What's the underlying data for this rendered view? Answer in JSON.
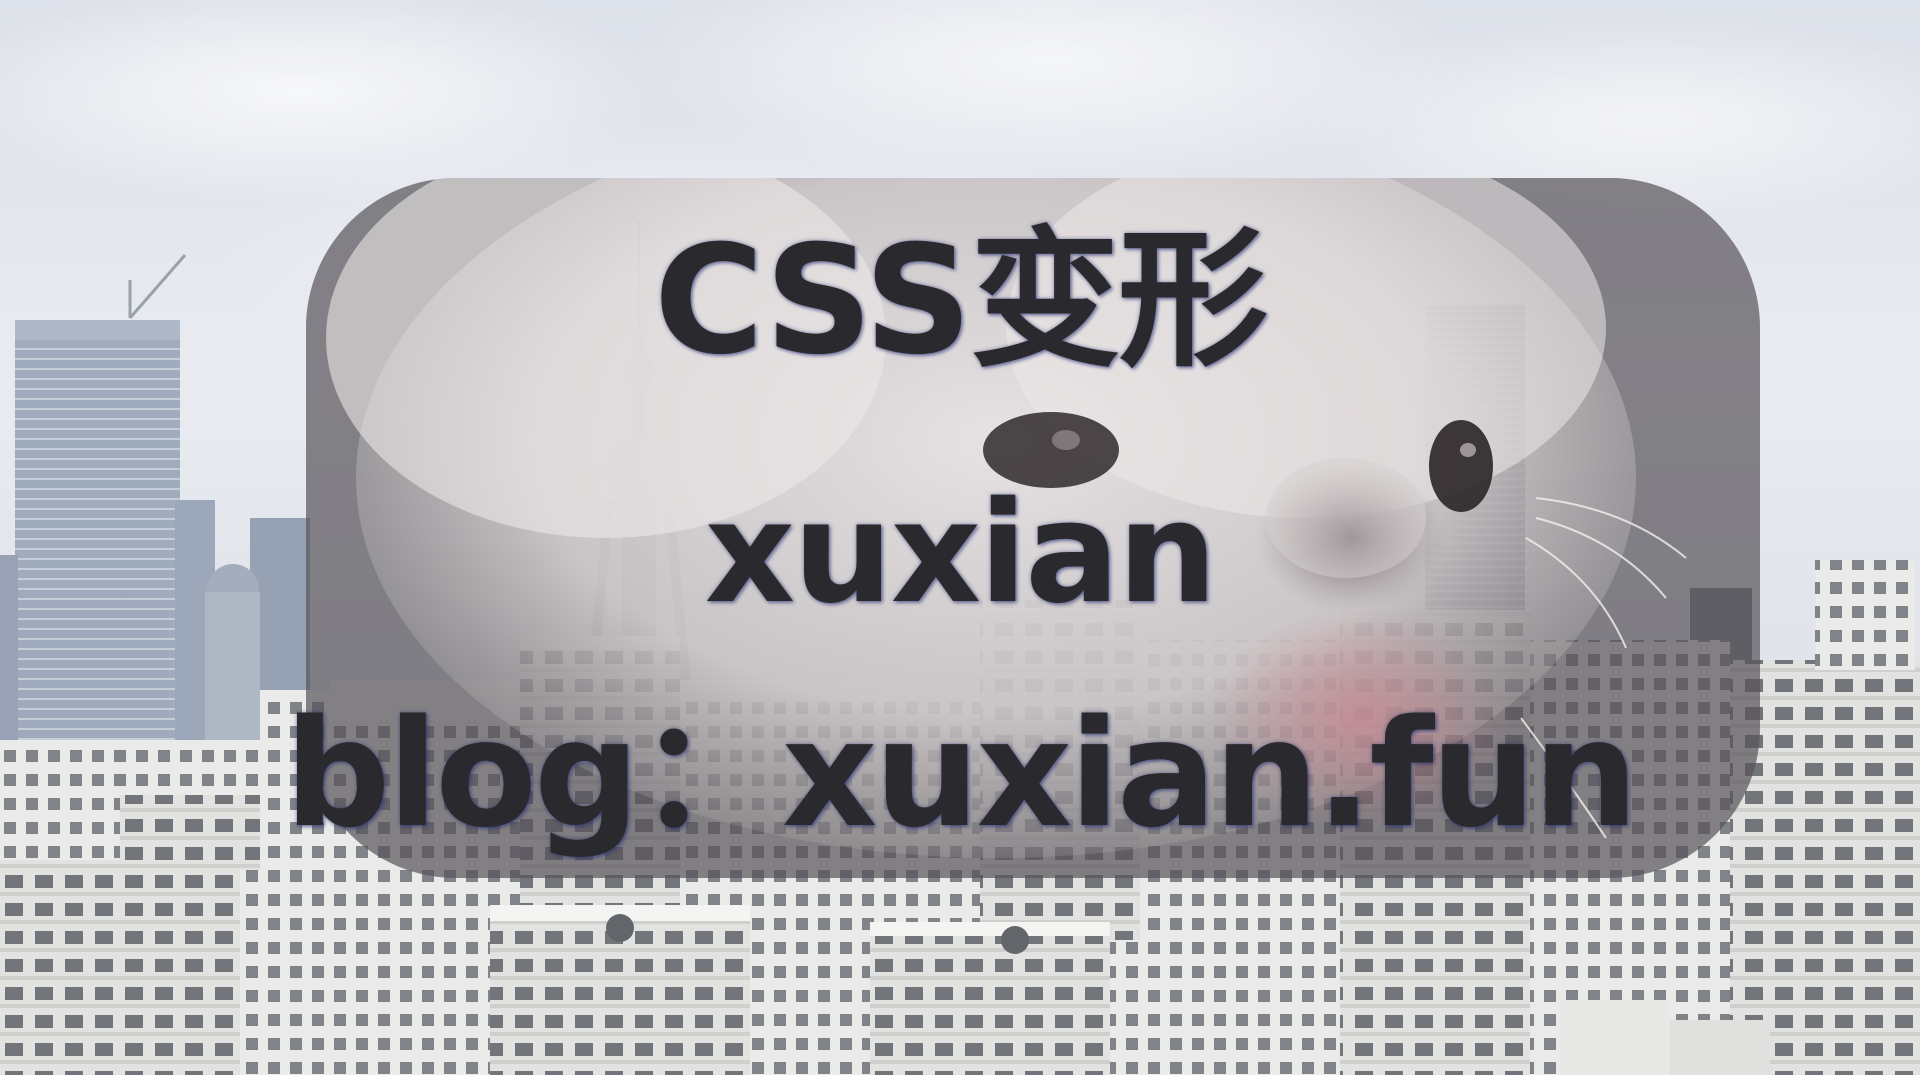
{
  "cover": {
    "title": "CSS变形",
    "author": "xuxian",
    "blog": "blog：xuxian.fun"
  }
}
